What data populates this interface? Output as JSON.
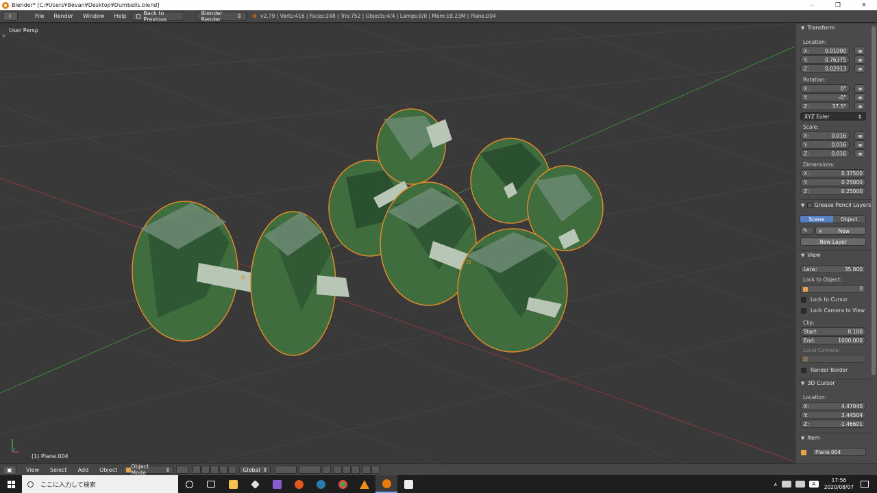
{
  "window": {
    "title": "Blender* [C:¥Users¥Bevan¥Desktop¥Dumbells.blend]",
    "minimize": "–",
    "restore": "❐",
    "close": "✕"
  },
  "topbar": {
    "editor_icon": "i",
    "menus": [
      "File",
      "Render",
      "Window",
      "Help"
    ],
    "back_button": "Back to Previous",
    "render_engine": "Blender Render",
    "stats": "v2.79 | Verts:416 | Faces:248 | Tris:752 | Objects:4/4 | Lamps:0/0 | Mem:19.23M | Plane.004"
  },
  "viewport": {
    "label": "User Persp",
    "object_label": "(1) Plane.004"
  },
  "panel": {
    "transform": {
      "header": "Transform",
      "location_label": "Location:",
      "location": [
        {
          "axis": "X:",
          "value": "0.01000"
        },
        {
          "axis": "Y:",
          "value": "0.76375"
        },
        {
          "axis": "Z:",
          "value": "0.02913"
        }
      ],
      "rotation_label": "Rotation:",
      "rotation": [
        {
          "axis": "X:",
          "value": "0°"
        },
        {
          "axis": "Y:",
          "value": "-0°"
        },
        {
          "axis": "Z:",
          "value": "37.5°"
        }
      ],
      "rotation_mode": "XYZ Euler",
      "scale_label": "Scale:",
      "scale": [
        {
          "axis": "X:",
          "value": "0.016"
        },
        {
          "axis": "Y:",
          "value": "0.016"
        },
        {
          "axis": "Z:",
          "value": "0.016"
        }
      ],
      "dimensions_label": "Dimensions:",
      "dimensions": [
        {
          "axis": "X:",
          "value": "0.37500"
        },
        {
          "axis": "Y:",
          "value": "0.25000"
        },
        {
          "axis": "Z:",
          "value": "0.25000"
        }
      ]
    },
    "grease": {
      "header": "Grease Pencil Layers",
      "scene": "Scene",
      "object": "Object",
      "new": "New",
      "new_layer": "New Layer"
    },
    "view": {
      "header": "View",
      "lens_label": "Lens:",
      "lens_value": "35.000",
      "lock_object_label": "Lock to Object:",
      "lock_cursor": "Lock to Cursor",
      "lock_camera": "Lock Camera to View",
      "clip_label": "Clip:",
      "clip_start_label": "Start:",
      "clip_start": "0.100",
      "clip_end_label": "End:",
      "clip_end": "1000.000",
      "local_camera": "Local Camera:",
      "render_border": "Render Border"
    },
    "cursor": {
      "header": "3D Cursor",
      "location_label": "Location:",
      "location": [
        {
          "axis": "X:",
          "value": "4.47040"
        },
        {
          "axis": "Y:",
          "value": "3.44504"
        },
        {
          "axis": "Z:",
          "value": "-1.46601"
        }
      ]
    },
    "item": {
      "header": "Item",
      "name": "Plane.004"
    }
  },
  "bottombar": {
    "menus": [
      "View",
      "Select",
      "Add",
      "Object"
    ],
    "mode": "Object Mode",
    "orientation": "Global"
  },
  "taskbar": {
    "search_placeholder": "ここに入力して検索",
    "time": "17:56",
    "date": "2020/08/07"
  },
  "colors": {
    "viewport_bg": "#393939",
    "dumbbell_green": "#3f6d3e",
    "dumbbell_dark": "#24452a",
    "dumbbell_light": "#6e8b74",
    "handle": "#b8c7b5",
    "outline": "#e28a2b",
    "active_blue": "#5680c2"
  }
}
